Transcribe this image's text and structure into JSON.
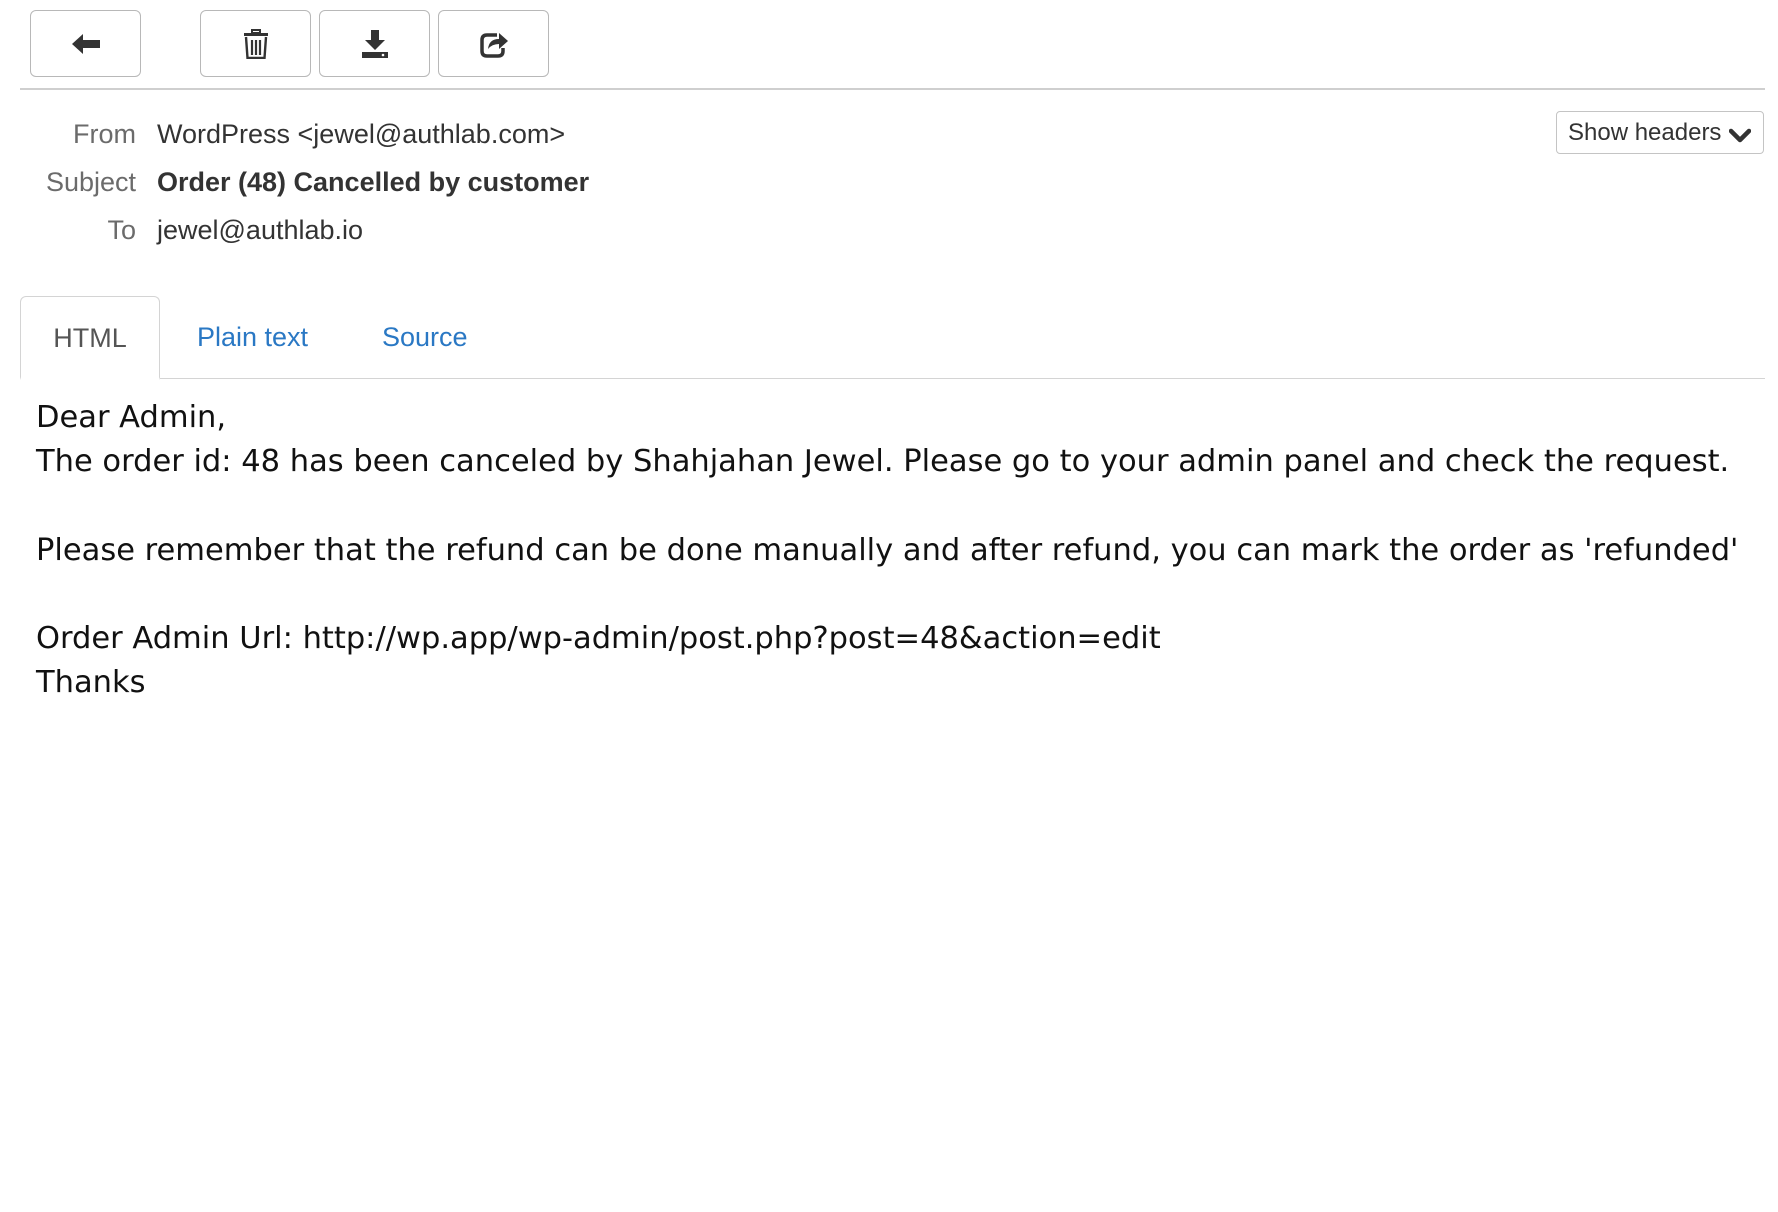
{
  "toolbar": {
    "buttons": [
      {
        "name": "back",
        "icon": "arrow-left-icon"
      },
      {
        "name": "delete",
        "icon": "trash-icon"
      },
      {
        "name": "download",
        "icon": "download-icon"
      },
      {
        "name": "forward",
        "icon": "share-icon"
      }
    ]
  },
  "headers": {
    "from_label": "From",
    "from_value": "WordPress <jewel@authlab.com>",
    "subject_label": "Subject",
    "subject_value": "Order (48) Cancelled by customer",
    "to_label": "To",
    "to_value": "jewel@authlab.io",
    "show_headers_label": "Show headers",
    "show_headers_icon": "chevron-down-icon"
  },
  "tabs": [
    {
      "label": "HTML",
      "active": true
    },
    {
      "label": "Plain text",
      "active": false
    },
    {
      "label": "Source",
      "active": false
    }
  ],
  "message": {
    "lines": [
      "Dear Admin,",
      "The order id: 48 has been canceled by Shahjahan Jewel. Please go to your admin panel and check the request.",
      "",
      "Please remember that the refund can be done manually and after refund, you can mark the order as 'refunded'",
      "",
      "Order Admin Url: http://wp.app/wp-admin/post.php?post=48&action=edit",
      "Thanks"
    ]
  },
  "colors": {
    "link": "#2a78c4",
    "label": "#6b6b6b",
    "text": "#333333",
    "border": "#c4c4c4"
  }
}
